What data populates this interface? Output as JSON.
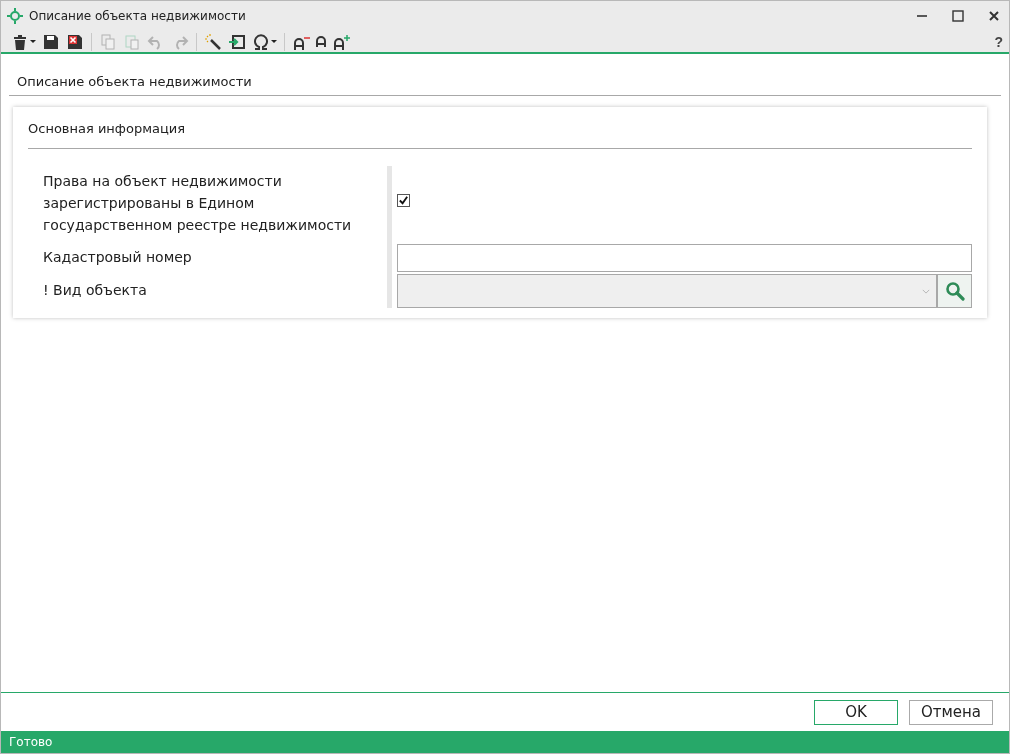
{
  "window": {
    "title": "Описание объекта недвижимости",
    "controls": [
      {
        "kind": "minimize"
      },
      {
        "kind": "maximize"
      },
      {
        "kind": "close"
      }
    ]
  },
  "toolbar": [
    {
      "kind": "trash",
      "dropdown": true,
      "disabled": false
    },
    {
      "kind": "save",
      "dropdown": false,
      "disabled": false
    },
    {
      "kind": "save-close",
      "dropdown": false,
      "disabled": false
    },
    {
      "kind": "sep"
    },
    {
      "kind": "copy",
      "dropdown": false,
      "disabled": true
    },
    {
      "kind": "paste",
      "dropdown": false,
      "disabled": true
    },
    {
      "kind": "undo",
      "dropdown": false,
      "disabled": true
    },
    {
      "kind": "redo",
      "dropdown": false,
      "disabled": true
    },
    {
      "kind": "sep"
    },
    {
      "kind": "wand",
      "dropdown": false,
      "disabled": false
    },
    {
      "kind": "import",
      "dropdown": false,
      "disabled": false
    },
    {
      "kind": "omega",
      "dropdown": true,
      "disabled": false
    },
    {
      "kind": "sep"
    },
    {
      "kind": "font-smaller",
      "dropdown": false,
      "disabled": false
    },
    {
      "kind": "font-normal",
      "dropdown": false,
      "disabled": false
    },
    {
      "kind": "font-larger",
      "dropdown": false,
      "disabled": false
    }
  ],
  "help": "?",
  "page_title": "Описание объекта недвижимости",
  "section": {
    "title": "Основная информация",
    "fields": [
      {
        "kind": "checkbox",
        "label": "Права на объект недвижимости зарегистрированы в Едином государственном реестре недвижимости",
        "checked": true
      },
      {
        "kind": "text",
        "label": "Кадастровый номер"
      },
      {
        "kind": "lookup",
        "label": "! Вид объекта",
        "disabled": true
      }
    ]
  },
  "buttons": [
    {
      "label": "OK",
      "default": true
    },
    {
      "label": "Отмена",
      "default": false
    }
  ],
  "status_bar": "Готово"
}
